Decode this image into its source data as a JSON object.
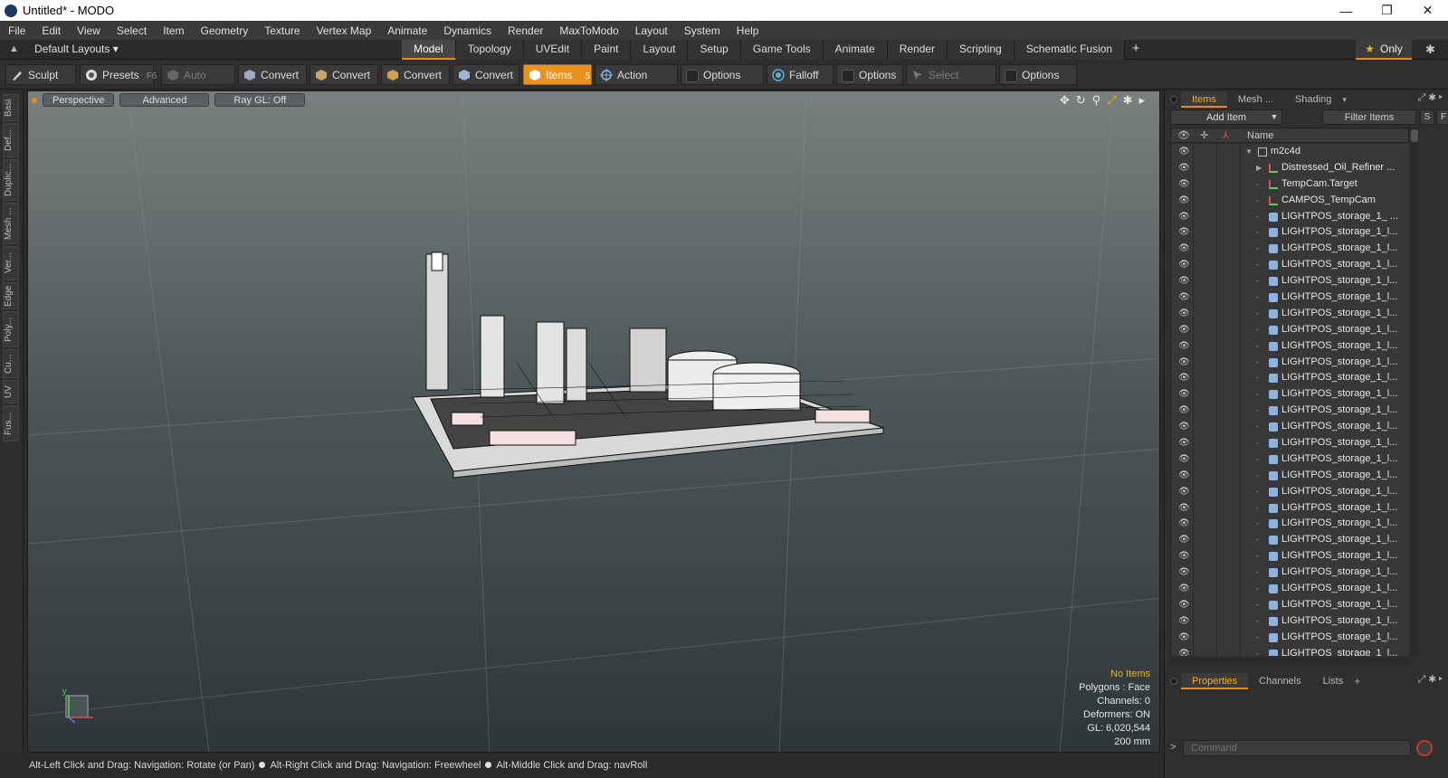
{
  "window": {
    "title": "Untitled* - MODO",
    "controls": [
      "—",
      "❐",
      "✕"
    ]
  },
  "menu": [
    "File",
    "Edit",
    "View",
    "Select",
    "Item",
    "Geometry",
    "Texture",
    "Vertex Map",
    "Animate",
    "Dynamics",
    "Render",
    "MaxToModo",
    "Layout",
    "System",
    "Help"
  ],
  "layout_bar": {
    "default_layouts": "Default Layouts ▾",
    "tabs": [
      "Model",
      "Topology",
      "UVEdit",
      "Paint",
      "Layout",
      "Setup",
      "Game Tools",
      "Animate",
      "Render",
      "Scripting",
      "Schematic Fusion"
    ],
    "active_tab": "Model",
    "plus": "+",
    "only_label": "Only"
  },
  "toolbar": {
    "sculpt": "Sculpt",
    "presets": "Presets",
    "presets_hotkey": "F6",
    "auto_select": "Auto Select",
    "convert": "Convert",
    "items": "Items",
    "items_hotkey": "5",
    "action_center": "Action Center",
    "options": "Options",
    "falloff": "Falloff",
    "select_through": "Select Through"
  },
  "left_tabs": [
    "Basi",
    "Def...",
    "Duplic...",
    "Mesh ...",
    "Ver...",
    "Edge",
    "Poly...",
    "Cu...",
    "UV",
    "Fus..."
  ],
  "viewport": {
    "view_mode": "Perspective",
    "shading": "Advanced",
    "raygl": "Ray GL: Off",
    "info": {
      "selection": "No Items",
      "polygons": "Polygons : Face",
      "channels": "Channels: 0",
      "deformers": "Deformers: ON",
      "gl": "GL: 6,020,544",
      "scale": "200 mm"
    },
    "axis_label": "y"
  },
  "status_bar": {
    "hint1": "Alt-Left Click and Drag: Navigation: Rotate (or Pan)",
    "hint2": "Alt-Right Click and Drag: Navigation: Freewheel",
    "hint3": "Alt-Middle Click and Drag: navRoll"
  },
  "right_panel": {
    "tabs": [
      "Items",
      "Mesh ...",
      "Shading"
    ],
    "active_tab": "Items",
    "add_item": "Add Item",
    "filter_items": "Filter Items",
    "s_btn": "S",
    "f_btn": "F",
    "name_column": "Name",
    "tree": [
      {
        "label": "m2c4d",
        "type": "group",
        "indent": 0,
        "expanded": true
      },
      {
        "label": "Distressed_Oil_Refiner ...",
        "type": "locator",
        "indent": 1,
        "collapsed": true
      },
      {
        "label": "TempCam.Target",
        "type": "locator",
        "indent": 1
      },
      {
        "label": "CAMPOS_TempCam",
        "type": "locator",
        "indent": 1
      },
      {
        "label": "LIGHTPOS_storage_1_ ...",
        "type": "mesh",
        "indent": 1
      },
      {
        "label": "LIGHTPOS_storage_1_l...",
        "type": "mesh",
        "indent": 1
      },
      {
        "label": "LIGHTPOS_storage_1_l...",
        "type": "mesh",
        "indent": 1
      },
      {
        "label": "LIGHTPOS_storage_1_l...",
        "type": "mesh",
        "indent": 1
      },
      {
        "label": "LIGHTPOS_storage_1_l...",
        "type": "mesh",
        "indent": 1
      },
      {
        "label": "LIGHTPOS_storage_1_l...",
        "type": "mesh",
        "indent": 1
      },
      {
        "label": "LIGHTPOS_storage_1_l...",
        "type": "mesh",
        "indent": 1
      },
      {
        "label": "LIGHTPOS_storage_1_l...",
        "type": "mesh",
        "indent": 1
      },
      {
        "label": "LIGHTPOS_storage_1_l...",
        "type": "mesh",
        "indent": 1
      },
      {
        "label": "LIGHTPOS_storage_1_l...",
        "type": "mesh",
        "indent": 1
      },
      {
        "label": "LIGHTPOS_storage_1_l...",
        "type": "mesh",
        "indent": 1
      },
      {
        "label": "LIGHTPOS_storage_1_l...",
        "type": "mesh",
        "indent": 1
      },
      {
        "label": "LIGHTPOS_storage_1_l...",
        "type": "mesh",
        "indent": 1
      },
      {
        "label": "LIGHTPOS_storage_1_l...",
        "type": "mesh",
        "indent": 1
      },
      {
        "label": "LIGHTPOS_storage_1_l...",
        "type": "mesh",
        "indent": 1
      },
      {
        "label": "LIGHTPOS_storage_1_l...",
        "type": "mesh",
        "indent": 1
      },
      {
        "label": "LIGHTPOS_storage_1_l...",
        "type": "mesh",
        "indent": 1
      },
      {
        "label": "LIGHTPOS_storage_1_l...",
        "type": "mesh",
        "indent": 1
      },
      {
        "label": "LIGHTPOS_storage_1_l...",
        "type": "mesh",
        "indent": 1
      },
      {
        "label": "LIGHTPOS_storage_1_l...",
        "type": "mesh",
        "indent": 1
      },
      {
        "label": "LIGHTPOS_storage_1_l...",
        "type": "mesh",
        "indent": 1
      },
      {
        "label": "LIGHTPOS_storage_1_l...",
        "type": "mesh",
        "indent": 1
      },
      {
        "label": "LIGHTPOS_storage_1_l...",
        "type": "mesh",
        "indent": 1
      },
      {
        "label": "LIGHTPOS_storage_1_l...",
        "type": "mesh",
        "indent": 1
      },
      {
        "label": "LIGHTPOS_storage_1_l...",
        "type": "mesh",
        "indent": 1
      },
      {
        "label": "LIGHTPOS_storage_1_l...",
        "type": "mesh",
        "indent": 1
      },
      {
        "label": "LIGHTPOS_storage_1_l...",
        "type": "mesh",
        "indent": 1
      },
      {
        "label": "LIGHTPOS_storage_1_l...",
        "type": "mesh",
        "indent": 1
      }
    ],
    "bottom_tabs": [
      "Properties",
      "Channels",
      "Lists"
    ],
    "bottom_active": "Properties",
    "command_placeholder": "Command"
  },
  "colors": {
    "accent": "#e88a1e",
    "highlight_text": "#f0b11e",
    "panel_bg": "#2f2f2f"
  }
}
